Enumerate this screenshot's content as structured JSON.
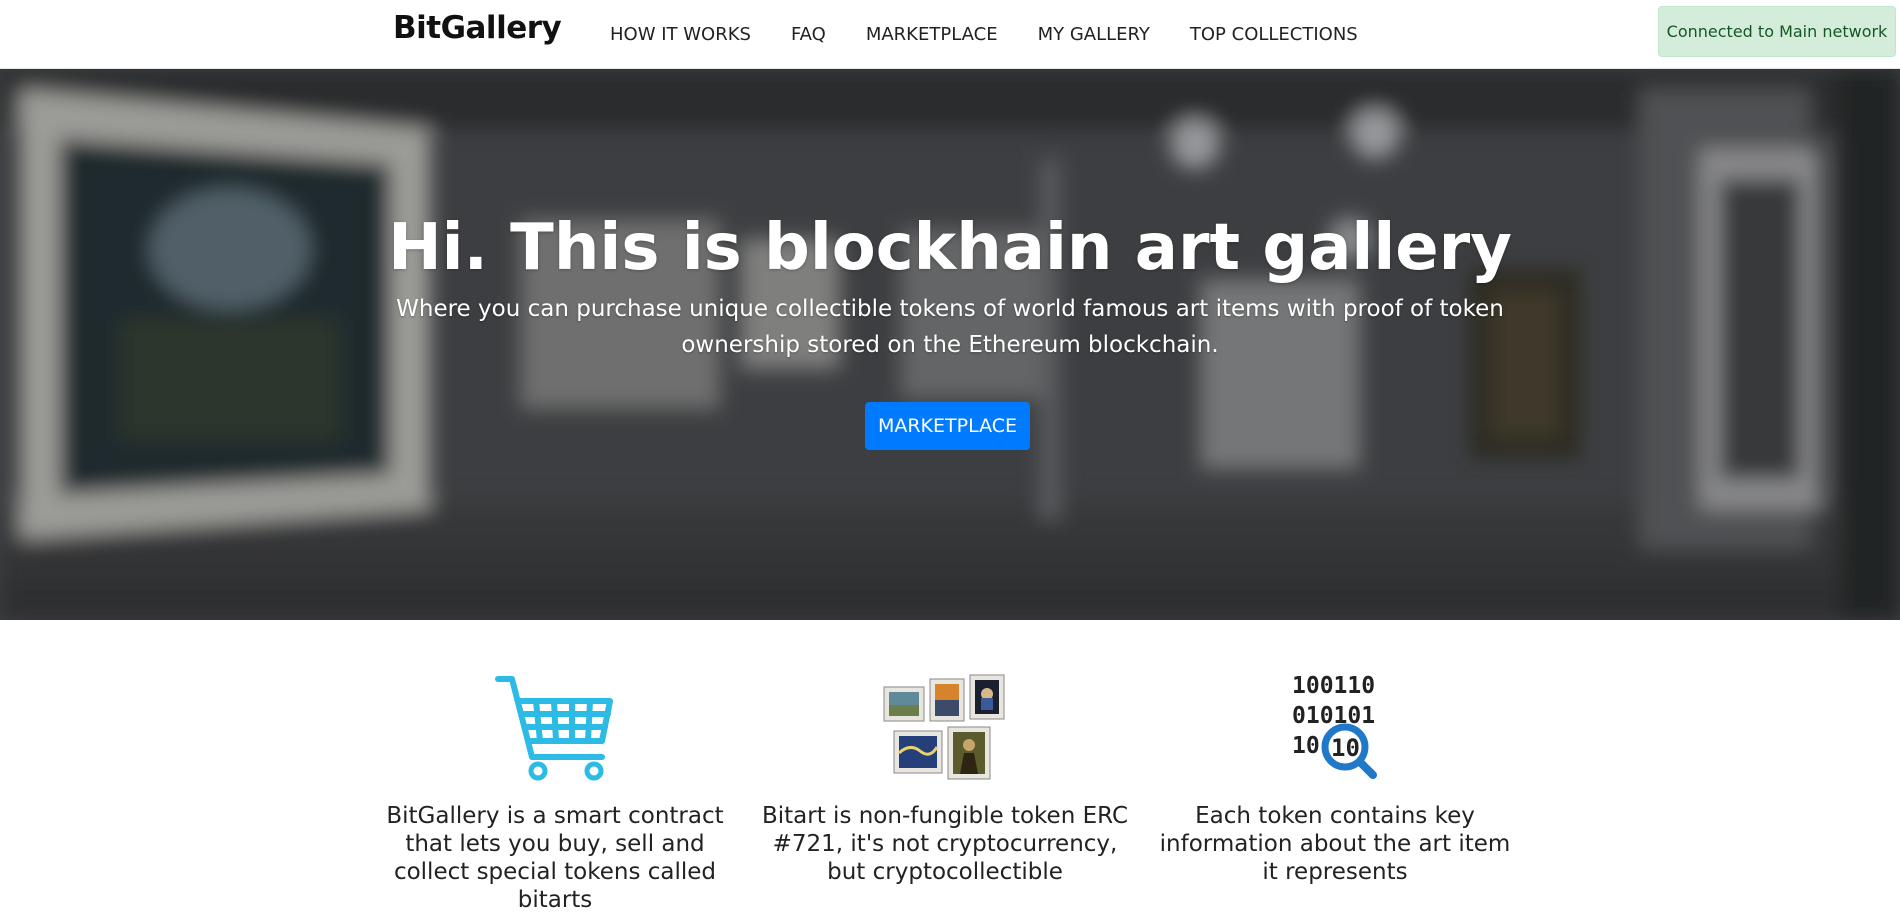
{
  "navbar": {
    "brand": "BitGallery",
    "links": [
      "HOW IT WORKS",
      "FAQ",
      "MARKETPLACE",
      "MY GALLERY",
      "TOP COLLECTIONS"
    ],
    "network_status": "Connected to Main network"
  },
  "hero": {
    "title": "Hi. This is blockhain art gallery",
    "subtitle": "Where you can purchase unique collectible tokens of world famous art items with proof of token ownership stored on the Ethereum blockchain.",
    "button_label": "MARKETPLACE"
  },
  "features": [
    {
      "icon": "shopping-cart-icon",
      "text": "BitGallery is a smart contract that lets you buy, sell and collect special tokens called bitarts"
    },
    {
      "icon": "framed-paintings-icon",
      "text": "Bitart is non-fungible token ERC #721, it's not cryptocurrency, but cryptocollectible"
    },
    {
      "icon": "binary-magnifier-icon",
      "binary_rows": [
        "100110",
        "010101",
        "10",
        "10"
      ],
      "text": "Each token contains key information about the art item it represents"
    }
  ],
  "colors": {
    "primary": "#007bff",
    "network_bg": "#d4edda",
    "network_text": "#155724",
    "cart": "#2bbbe4",
    "magnifier": "#1f78c8"
  }
}
